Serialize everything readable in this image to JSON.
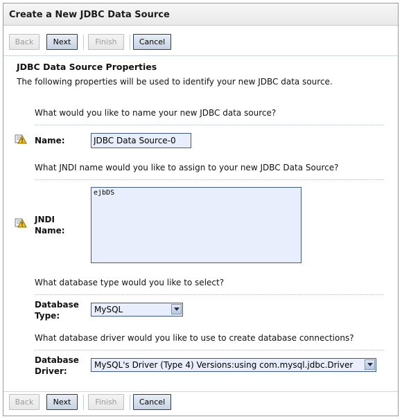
{
  "window": {
    "title": "Create a New JDBC Data Source"
  },
  "toolbar": {
    "back_label": "Back",
    "next_label": "Next",
    "finish_label": "Finish",
    "cancel_label": "Cancel"
  },
  "section": {
    "title": "JDBC Data Source Properties",
    "description": "The following properties will be used to identify your new JDBC data source."
  },
  "fields": {
    "name": {
      "question": "What would you like to name your new JDBC data source?",
      "label": "Name:",
      "value": "JDBC Data Source-0",
      "icon": "required-warning-icon"
    },
    "jndi": {
      "question": "What JNDI name would you like to assign to your new JDBC Data Source?",
      "label_line1": "JNDI",
      "label_line2": "Name:",
      "value": "ejbDS",
      "icon": "required-warning-icon"
    },
    "db_type": {
      "question": "What database type would you like to select?",
      "label_line1": "Database",
      "label_line2": "Type:",
      "selected": "MySQL"
    },
    "db_driver": {
      "question": "What database driver would you like to use to create database connections?",
      "label_line1": "Database",
      "label_line2": "Driver:",
      "selected": "MySQL's Driver (Type 4) Versions:using com.mysql.jdbc.Driver"
    }
  },
  "colors": {
    "input_bg": "#e8eefb",
    "input_border": "#3d5a86",
    "button_border": "#2a3c55"
  }
}
